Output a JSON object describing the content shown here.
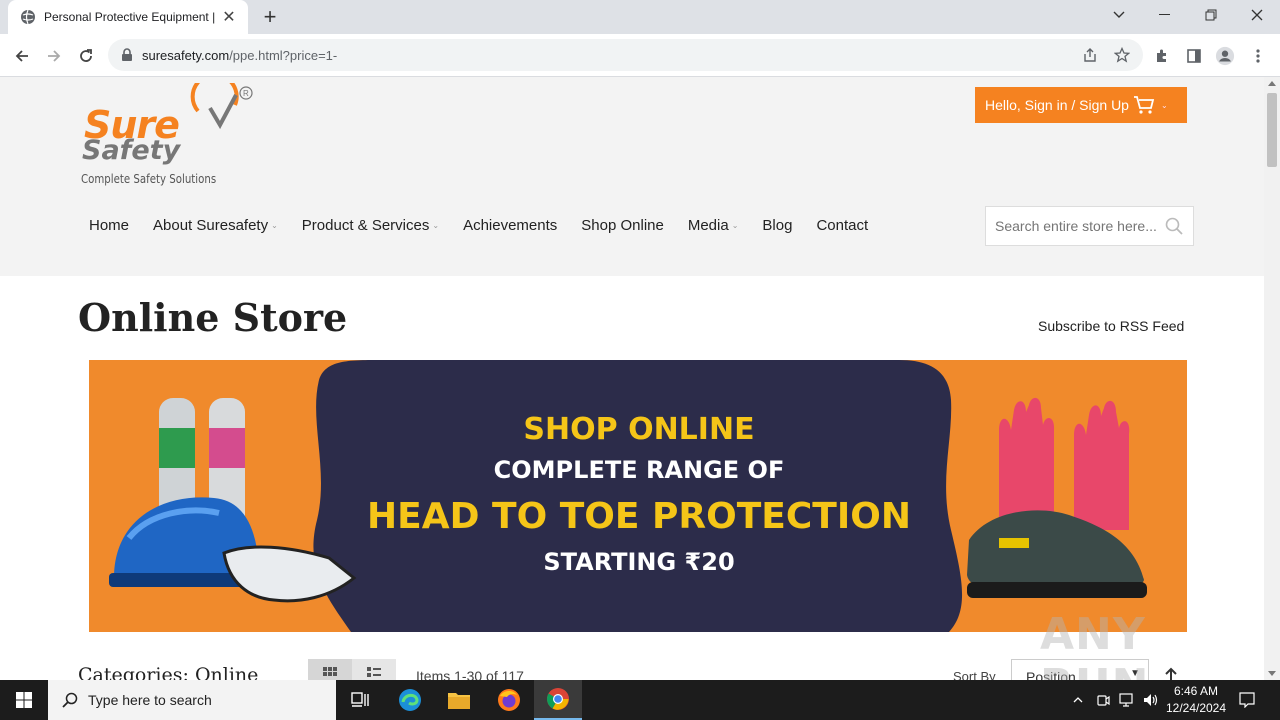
{
  "browser": {
    "tab_title": "Personal Protective Equipment |",
    "url_host": "suresafety.com",
    "url_path": "/ppe.html?price=1-"
  },
  "site": {
    "logo_text_1": "Sure",
    "logo_text_2": "Safety",
    "logo_tagline": "Complete Safety Solutions",
    "signin_label": "Hello, Sign in / Sign Up",
    "nav": [
      {
        "label": "Home",
        "has_dropdown": false
      },
      {
        "label": "About Suresafety",
        "has_dropdown": true
      },
      {
        "label": "Product & Services",
        "has_dropdown": true
      },
      {
        "label": "Achievements",
        "has_dropdown": false
      },
      {
        "label": "Shop Online",
        "has_dropdown": false
      },
      {
        "label": "Media",
        "has_dropdown": true
      },
      {
        "label": "Blog",
        "has_dropdown": false
      },
      {
        "label": "Contact",
        "has_dropdown": false
      }
    ],
    "search_placeholder": "Search entire store here...",
    "brand_color": "#f58220"
  },
  "main": {
    "page_title": "Online Store",
    "rss_link": "Subscribe to RSS Feed",
    "banner": {
      "line1": "SHOP ONLINE",
      "line2": "COMPLETE RANGE OF",
      "line3": "HEAD TO TOE PROTECTION",
      "line4": "STARTING ₹20"
    },
    "category_title": "Categories: Online",
    "items_count": "Items 1-30 of 117",
    "sort_label": "Sort By",
    "sort_value": "Position"
  },
  "watermark": "ANY RUN",
  "taskbar": {
    "search_placeholder": "Type here to search",
    "time": "6:46 AM",
    "date": "12/24/2024"
  }
}
